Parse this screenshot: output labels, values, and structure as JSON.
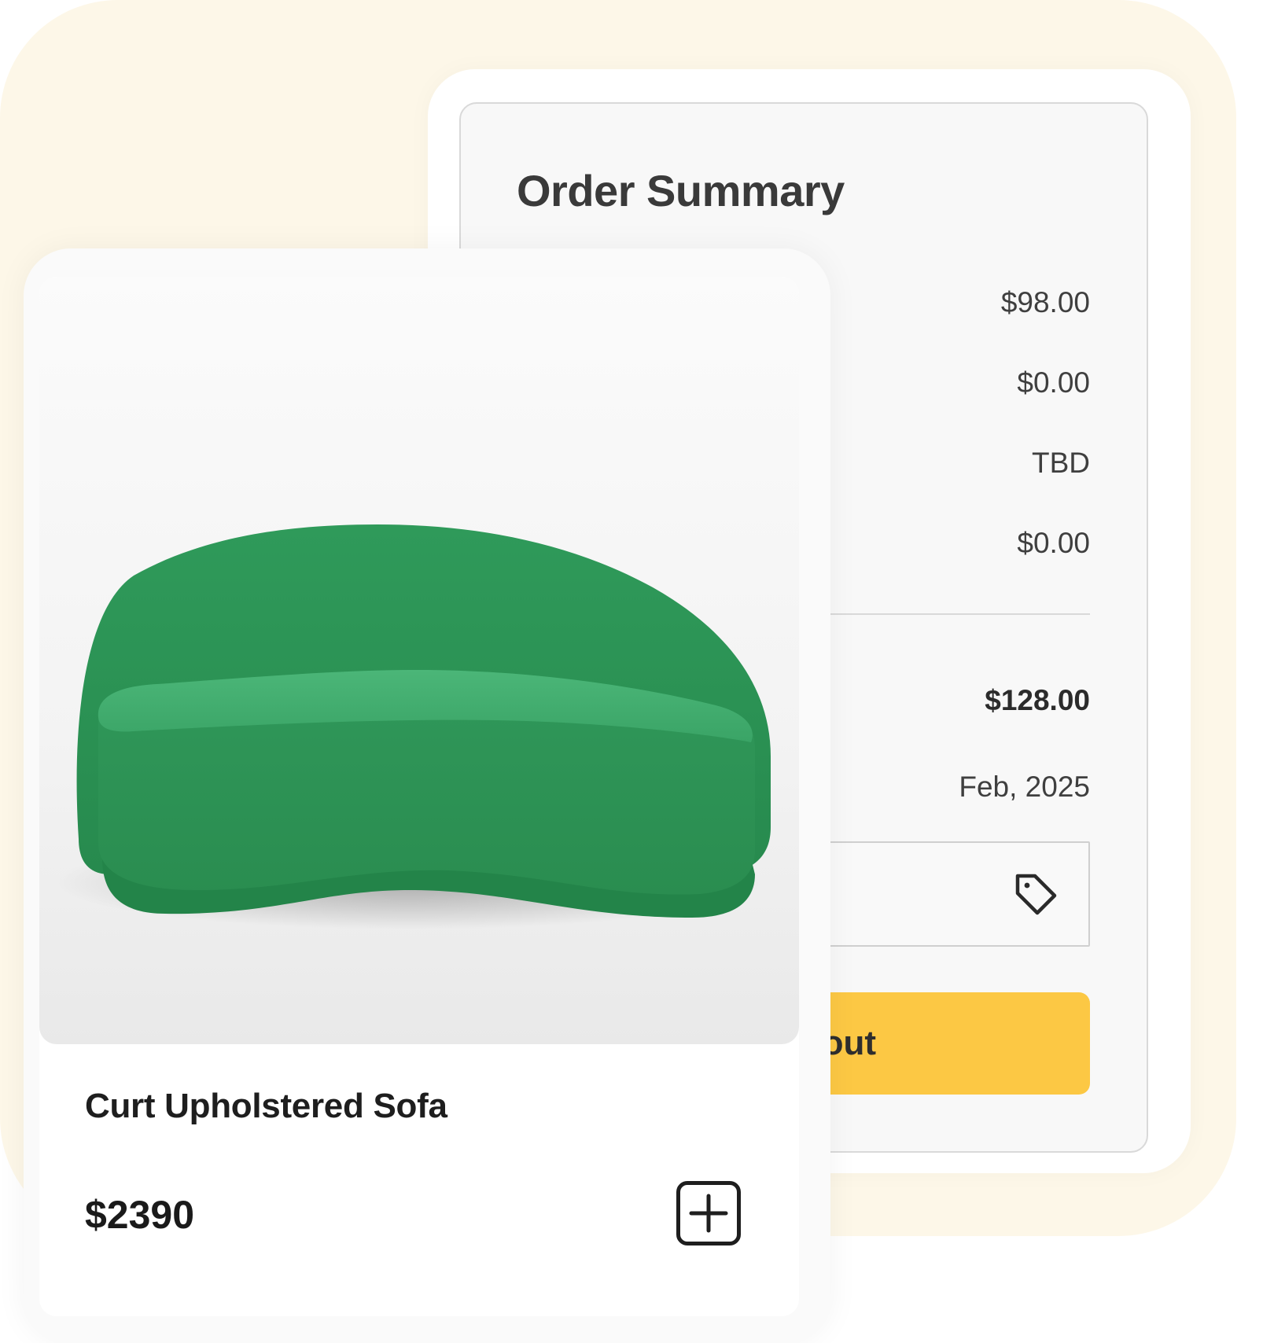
{
  "order_summary": {
    "title": "Order Summary",
    "rows": [
      {
        "value": "$98.00"
      },
      {
        "value": "$0.00"
      },
      {
        "value": "TBD"
      },
      {
        "value": "$0.00"
      }
    ],
    "total": "$128.00",
    "delivery_date": "Feb, 2025",
    "promo_icon": "tag-icon",
    "checkout_label": "out"
  },
  "product": {
    "name": "Curt Upholstered Sofa",
    "price": "$2390",
    "image_icon": "sofa-image",
    "add_icon": "plus-square-icon",
    "colors": {
      "sofa": "#2f9a5a",
      "accent": "#fcc844"
    }
  }
}
